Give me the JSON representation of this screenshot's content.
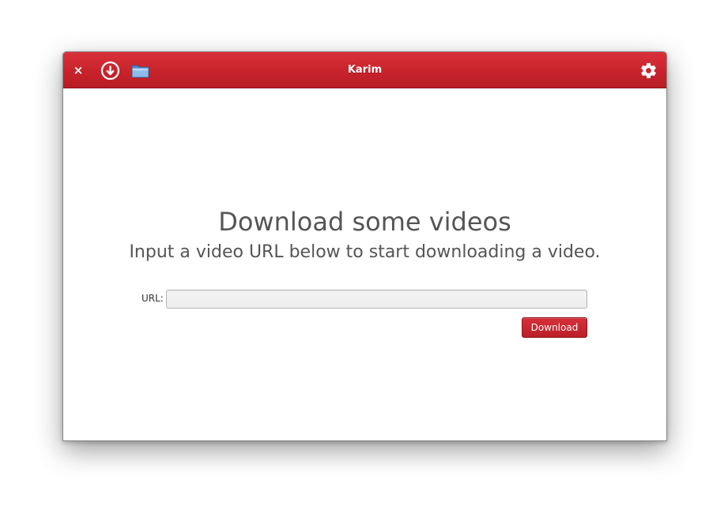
{
  "window": {
    "title": "Karim",
    "accent_color": "#c8232c"
  },
  "toolbar": {
    "close_glyph": "×",
    "close_icon": "close-icon",
    "download_icon": "download-circle-icon",
    "folder_icon": "folder-icon",
    "settings_icon": "gear-icon"
  },
  "main": {
    "headline": "Download some videos",
    "subtitle": "Input a video URL below to start downloading a video.",
    "url_label": "URL:",
    "url_value": "",
    "download_button_label": "Download"
  }
}
